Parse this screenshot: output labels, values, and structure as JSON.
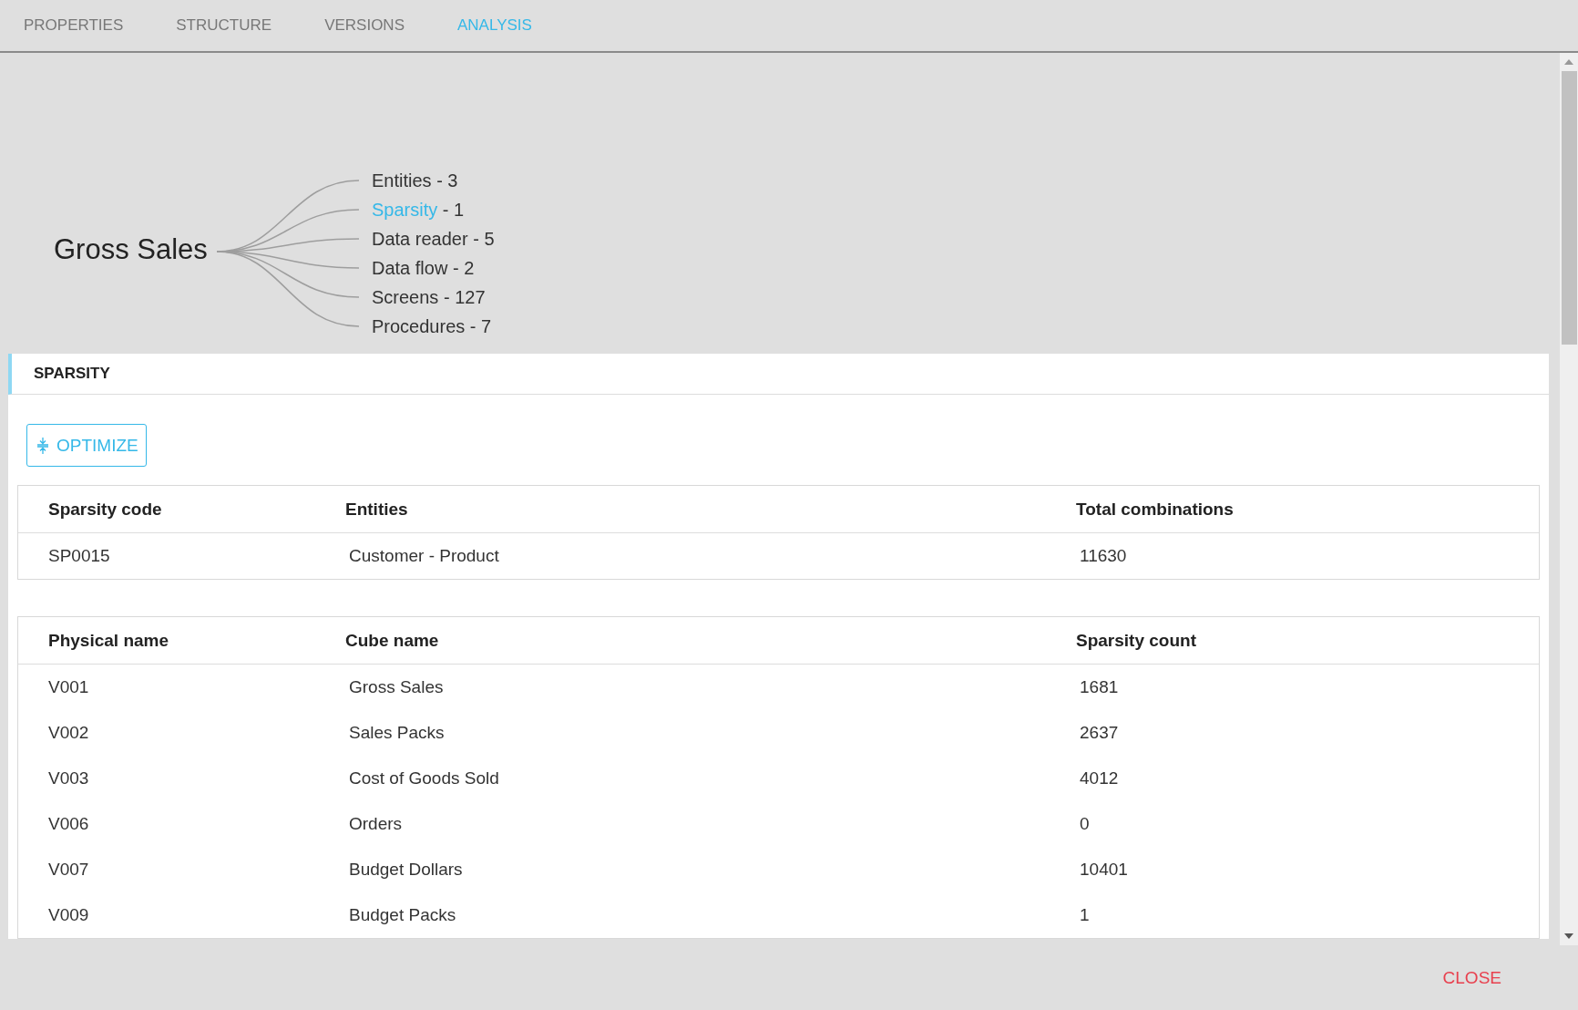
{
  "tabs": [
    {
      "label": "PROPERTIES",
      "selected": false
    },
    {
      "label": "STRUCTURE",
      "selected": false
    },
    {
      "label": "VERSIONS",
      "selected": false
    },
    {
      "label": "ANALYSIS",
      "selected": true
    }
  ],
  "analysis_tree": {
    "root": "Gross Sales",
    "branches": [
      {
        "name": "Entities",
        "suffix": " - 3",
        "selected": false
      },
      {
        "name": "Sparsity",
        "suffix": " - 1",
        "selected": true
      },
      {
        "name": "Data reader",
        "suffix": " - 5",
        "selected": false
      },
      {
        "name": "Data flow",
        "suffix": " - 2",
        "selected": false
      },
      {
        "name": "Screens",
        "suffix": " - 127",
        "selected": false
      },
      {
        "name": "Procedures",
        "suffix": " - 7",
        "selected": false
      }
    ]
  },
  "section": {
    "title": "SPARSITY",
    "optimize_button": "OPTIMIZE",
    "summary_table": {
      "columns": [
        "Sparsity code",
        "Entities",
        "Total combinations"
      ],
      "rows": [
        [
          "SP0015",
          "Customer - Product",
          "11630"
        ]
      ]
    },
    "cubes_table": {
      "columns": [
        "Physical name",
        "Cube name",
        "Sparsity count"
      ],
      "rows": [
        [
          "V001",
          "Gross Sales",
          "1681"
        ],
        [
          "V002",
          "Sales Packs",
          "2637"
        ],
        [
          "V003",
          "Cost of Goods Sold",
          "4012"
        ],
        [
          "V006",
          "Orders",
          "0"
        ],
        [
          "V007",
          "Budget Dollars",
          "10401"
        ],
        [
          "V009",
          "Budget Packs",
          "1"
        ]
      ]
    }
  },
  "footer": {
    "close_button": "CLOSE"
  }
}
